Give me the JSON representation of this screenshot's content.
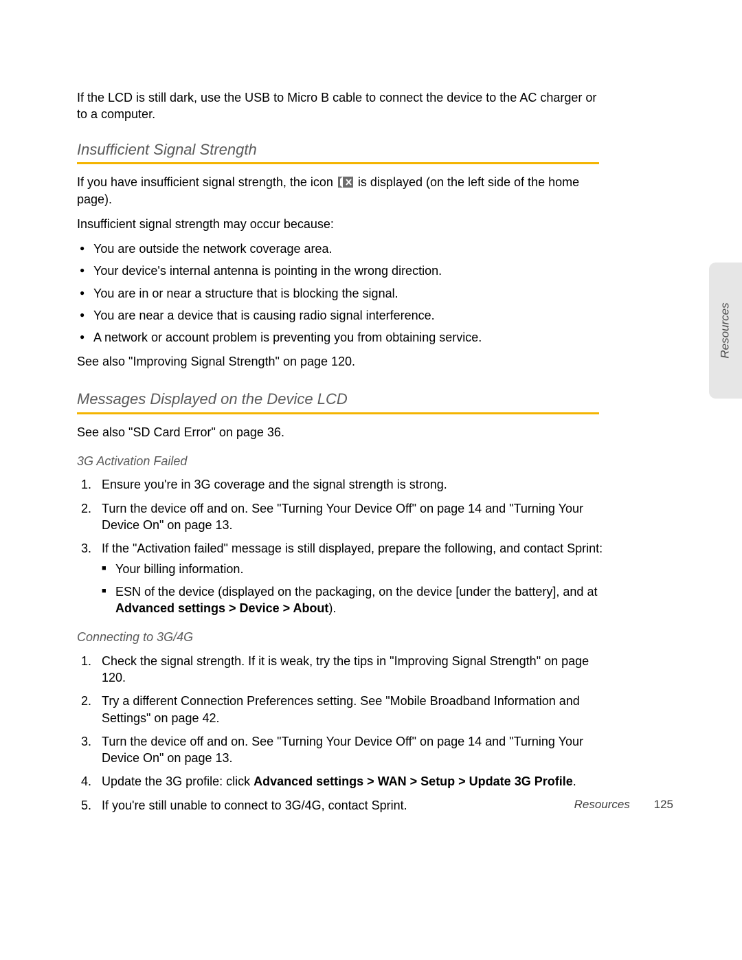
{
  "intro": "If the LCD is still dark, use the USB to Micro B cable to connect the device to the AC charger or to a computer.",
  "section1": {
    "title": "Insufficient Signal Strength",
    "p1a": "If you have insufficient signal strength, the icon ",
    "p1b": " is displayed (on the left side of the home page).",
    "p2": "Insufficient signal strength may occur because:",
    "bullets": [
      "You are outside the network coverage area.",
      "Your device's internal antenna is pointing in the wrong direction.",
      "You are in or near a structure that is blocking the signal.",
      "You are near a device that is causing radio signal interference.",
      "A network or account problem is preventing you from obtaining service."
    ],
    "p3": "See also \"Improving Signal Strength\" on page 120."
  },
  "section2": {
    "title": "Messages Displayed on the Device LCD",
    "p1": "See also \"SD Card Error\" on page 36.",
    "sub1": {
      "title": "3G Activation Failed",
      "items": {
        "i1": "Ensure you're in 3G coverage and the signal strength is strong.",
        "i2": "Turn the device off and on. See \"Turning Your Device Off\" on page 14 and \"Turning Your Device On\" on page 13.",
        "i3": "If the \"Activation failed\" message is still displayed, prepare the following, and contact Sprint:",
        "i3a": "Your billing information.",
        "i3b_a": "ESN of the device (displayed on the packaging, on the device [under the battery], and at ",
        "i3b_bold": "Advanced settings > Device > About",
        "i3b_b": ")."
      }
    },
    "sub2": {
      "title": "Connecting to 3G/4G",
      "items": {
        "i1": "Check the signal strength. If it is weak, try the tips in \"Improving Signal Strength\" on page 120.",
        "i2": "Try a different Connection Preferences setting. See \"Mobile Broadband Information and Settings\" on page 42.",
        "i3": "Turn the device off and on. See \"Turning Your Device Off\" on page 14 and \"Turning Your Device On\" on page 13.",
        "i4a": "Update the 3G profile: click ",
        "i4bold": "Advanced settings > WAN > Setup > Update 3G Profile",
        "i4b": ".",
        "i5": "If you're still unable to connect to 3G/4G, contact Sprint."
      }
    }
  },
  "sideTab": "Resources",
  "footer": {
    "label": "Resources",
    "page": "125"
  }
}
